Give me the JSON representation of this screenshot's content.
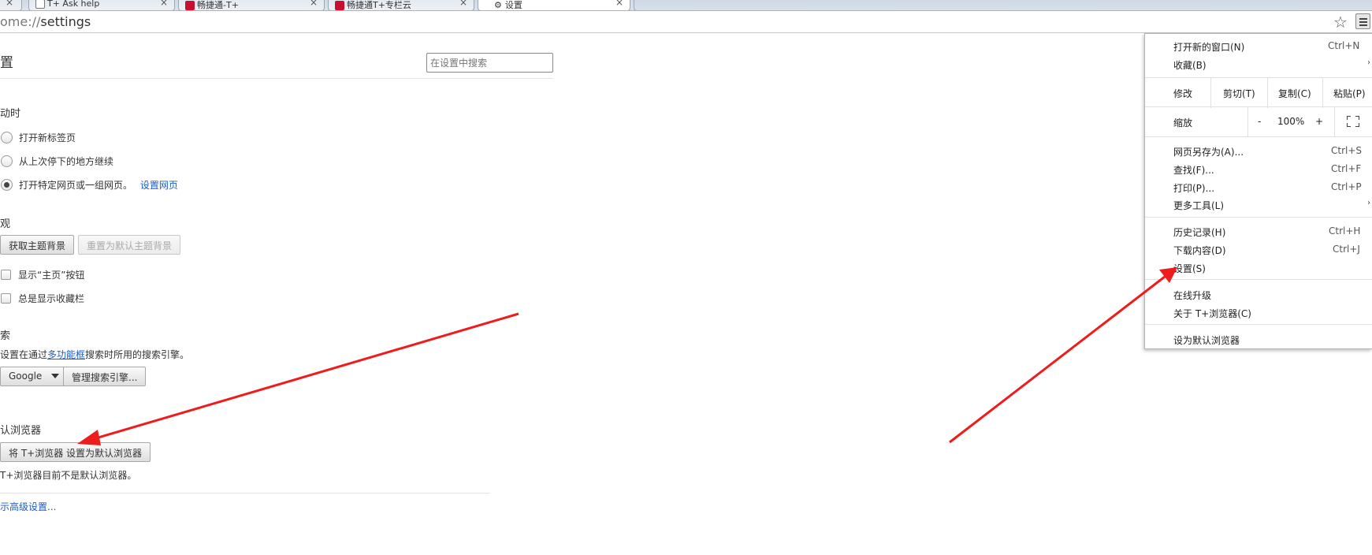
{
  "tabs": [
    {
      "label": "T+ Ask help",
      "close": "×"
    },
    {
      "label": "畅捷通-T+",
      "close": "×"
    },
    {
      "label": "畅捷通T+专栏云",
      "close": "×"
    },
    {
      "label": "设置",
      "close": "×"
    }
  ],
  "address": {
    "scheme": "ome://",
    "path": "settings"
  },
  "page": {
    "title": "置",
    "search_placeholder": "在设置中搜索",
    "startup": {
      "heading": "动时",
      "options": [
        {
          "label": "打开新标签页",
          "selected": false
        },
        {
          "label": "从上次停下的地方继续",
          "selected": false
        },
        {
          "label": "打开特定网页或一组网页。",
          "selected": true,
          "link": "设置网页"
        }
      ]
    },
    "appearance": {
      "heading": "观",
      "get_themes": "获取主题背景",
      "reset_theme": "重置为默认主题背景",
      "show_home": "显示“主页”按钮",
      "show_bookmarks": "总是显示收藏栏"
    },
    "search": {
      "heading": "索",
      "desc_pre": "设置在通过",
      "desc_link": "多功能框",
      "desc_post": "搜索时所用的搜索引擎。",
      "engine": "Google",
      "manage": "管理搜索引擎..."
    },
    "default_browser": {
      "heading": "认浏览器",
      "button": "将 T+浏览器 设置为默认浏览器",
      "status": "T+浏览器目前不是默认浏览器。"
    },
    "advanced_link": "示高级设置..."
  },
  "menu": {
    "new_window": {
      "label": "打开新的窗口(N)",
      "shortcut": "Ctrl+N"
    },
    "bookmarks": "收藏(B)",
    "edit": {
      "label": "修改",
      "cut": "剪切(T)",
      "copy": "复制(C)",
      "paste": "粘贴(P)"
    },
    "zoom": {
      "label": "缩放",
      "minus": "-",
      "value": "100%",
      "plus": "+"
    },
    "save_page": {
      "label": "网页另存为(A)...",
      "shortcut": "Ctrl+S"
    },
    "find": {
      "label": "查找(F)...",
      "shortcut": "Ctrl+F"
    },
    "print": {
      "label": "打印(P)...",
      "shortcut": "Ctrl+P"
    },
    "more_tools": "更多工具(L)",
    "history": {
      "label": "历史记录(H)",
      "shortcut": "Ctrl+H"
    },
    "downloads": {
      "label": "下载内容(D)",
      "shortcut": "Ctrl+J"
    },
    "settings": "设置(S)",
    "upgrade": "在线升级",
    "about": "关于 T+浏览器(C)",
    "set_default": "设为默认浏览器"
  },
  "submenu_glyph": "›",
  "colors": {
    "arrow": "#ee1c1c",
    "link": "#1a5cc8",
    "focus": "#4d90fe"
  }
}
